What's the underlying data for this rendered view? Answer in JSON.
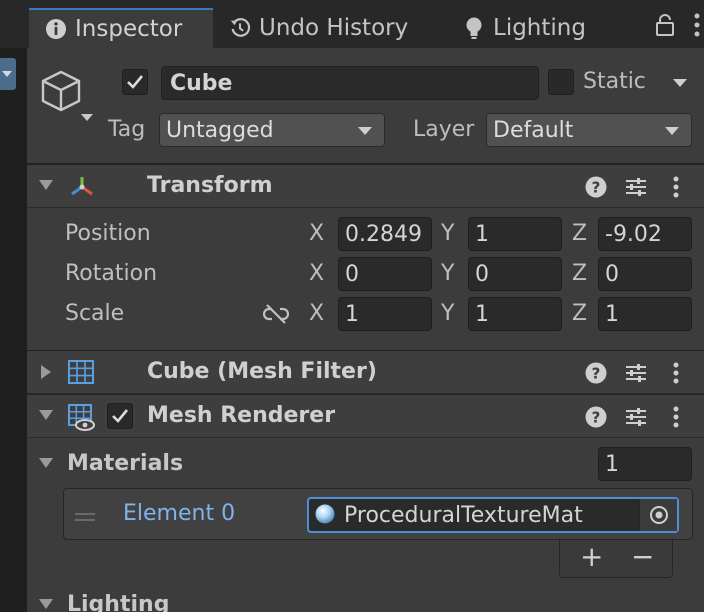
{
  "tabs": [
    {
      "label": "Inspector",
      "icon": "info-icon",
      "active": true
    },
    {
      "label": "Undo History",
      "icon": "history-icon",
      "active": false
    },
    {
      "label": "Lighting",
      "icon": "lightbulb-icon",
      "active": false
    }
  ],
  "object": {
    "active": true,
    "name": "Cube",
    "static_label": "Static",
    "static": false,
    "tag_label": "Tag",
    "tag": "Untagged",
    "layer_label": "Layer",
    "layer": "Default"
  },
  "transform": {
    "title": "Transform",
    "rows": [
      {
        "label": "Position",
        "x": "0.2849",
        "y": "1",
        "z": "-9.02"
      },
      {
        "label": "Rotation",
        "x": "0",
        "y": "0",
        "z": "0"
      },
      {
        "label": "Scale",
        "x": "1",
        "y": "1",
        "z": "1"
      }
    ],
    "axis": {
      "x": "X",
      "y": "Y",
      "z": "Z"
    }
  },
  "mesh_filter": {
    "title": "Cube (Mesh Filter)"
  },
  "mesh_renderer": {
    "title": "Mesh Renderer",
    "enabled": true
  },
  "materials": {
    "label": "Materials",
    "count": "1",
    "element_label": "Element 0",
    "element_value": "ProceduralTextureMat",
    "add": "+",
    "remove": "−"
  },
  "lighting": {
    "label": "Lighting"
  },
  "colors": {
    "accent": "#3a79bb",
    "focus": "#4d8fd6",
    "element_link": "#7fb3ec",
    "panel": "#3c3c3c",
    "field": "#2a2a2a"
  }
}
